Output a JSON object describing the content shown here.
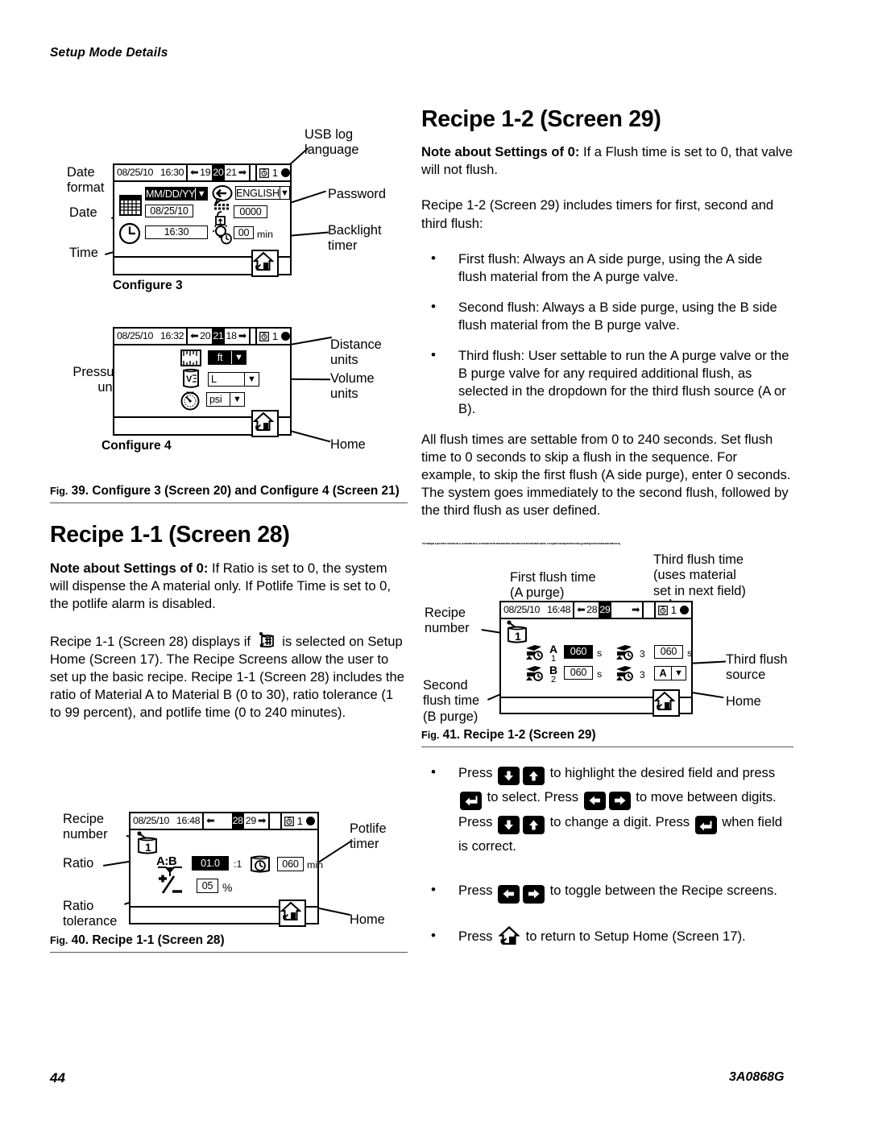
{
  "header": {
    "running_head": "Setup Mode Details"
  },
  "footer": {
    "page_number": "44",
    "doc_code": "3A0868G"
  },
  "left_column": {
    "fig39": {
      "caption_prefix": "Fig.",
      "caption": " 39. Configure 3 (Screen 20) and Configure 4 (Screen 21)",
      "screen_name_3": "Configure 3",
      "screen_name_4": "Configure 4",
      "callouts": {
        "date_format": "Date\nformat",
        "date": "Date",
        "time": "Time",
        "usb_log_language": "USB log\nlanguage",
        "password": "Password",
        "backlight_timer": "Backlight\ntimer",
        "pressure_units": "Pressure\nunits",
        "distance_units": "Distance\nunits",
        "volume_units": "Volume\nunits",
        "home": "Home"
      },
      "configure3": {
        "date_stamp": "08/25/10",
        "time_stamp": "16:30",
        "nav_prev": "19",
        "nav_cur": "20",
        "nav_next": "21",
        "status_num": "1",
        "date_format_value": "MM/DD/YY",
        "date_value": "08/25/10",
        "time_value": "16:30",
        "language_value": "ENGLISH",
        "password_value": "0000",
        "backlight_value": "00",
        "backlight_unit": "min"
      },
      "configure4": {
        "date_stamp": "08/25/10",
        "time_stamp": "16:32",
        "nav_prev": "20",
        "nav_cur": "21",
        "nav_next": "18",
        "status_num": "1",
        "distance_value": "ft",
        "volume_value": "L",
        "pressure_value": "psi"
      }
    },
    "recipe11": {
      "title": "Recipe 1-1 (Screen 28)",
      "note_label": "Note about Settings of 0:",
      "note_text": " If Ratio is set to 0, the system will dispense the A material only. If Potlife Time is set to 0, the potlife alarm is disabled.",
      "para_a": "Recipe 1-1 (Screen 28) displays if ",
      "para_b": " is selected on Setup Home (Screen 17). The Recipe Screens allow the user to set up the basic recipe. Recipe 1-1 (Screen 28) includes the ratio of Material A to Material B (0 to 30), ratio tolerance (1 to 99 percent), and potlife time (0 to 240 minutes)."
    },
    "fig40": {
      "caption_prefix": "Fig.",
      "caption": " 40. Recipe 1-1 (Screen 28)",
      "callouts": {
        "recipe_number": "Recipe\nnumber",
        "ratio": "Ratio",
        "ratio_tolerance": "Ratio\ntolerance",
        "potlife_timer": "Potlife\ntimer",
        "home": "Home"
      },
      "screen": {
        "date_stamp": "08/25/10",
        "time_stamp": "16:48",
        "nav_cur": "28",
        "nav_next": "29",
        "status_num": "1",
        "recipe_number_value": "1",
        "ratio_label": "A:B",
        "ratio_value": "01.0",
        "ratio_suffix": ":1",
        "tolerance_value": "05",
        "tolerance_unit": "%",
        "potlife_value": "060",
        "potlife_unit": "min"
      }
    }
  },
  "right_column": {
    "recipe12": {
      "title": "Recipe 1-2 (Screen 29)",
      "note_label": "Note about Settings of 0:",
      "note_text": " If a Flush time is set to 0, that valve will not flush.",
      "intro": "Recipe 1-2 (Screen 29) includes timers for first, second and third flush:",
      "bullets": [
        "First flush: Always an A side purge, using the A side flush material from the A purge valve.",
        "Second flush: Always a B side purge, using the B side flush material from the B purge valve.",
        "Third flush: User settable to run the A purge valve or the B purge valve for any required additional flush, as selected in the dropdown for the third flush source (A or B)."
      ],
      "para_after": "All flush times are settable from 0 to 240 seconds. Set flush time to 0 seconds to skip a flush in the sequence. For example, to skip the first flush (A side purge), enter 0 seconds. The system goes immediately to the second flush, followed by the third flush as user defined."
    },
    "overlap_line": "For example, if you enter 0 seconds for A, 30 seconds for B, 30 seconds for the third flush time, and select A for the third flush source. The system will skip the first A flush, go directly to the second flush with the B purge valve for 30 seconds followed by the",
    "fig41": {
      "caption_prefix": "Fig.",
      "caption": " 41. Recipe 1-2 (Screen 29)",
      "callouts": {
        "recipe_number": "Recipe\nnumber",
        "first_flush": "First flush time\n(A purge)",
        "third_flush_time": "Third flush time\n(uses material\nset in next field)",
        "third_flush_source": "Third flush\nsource",
        "second_flush": "Second\nflush time\n(B purge)",
        "home": "Home"
      },
      "screen": {
        "date_stamp": "08/25/10",
        "time_stamp": "16:48",
        "nav_prev": "28",
        "nav_cur": "29",
        "status_num": "1",
        "recipe_number_value": "1",
        "flush_a_letter": "A",
        "flush_a_index": "1",
        "flush_a_value": "060",
        "flush_a_unit": "s",
        "flush_b_letter": "B",
        "flush_b_index": "2",
        "flush_b_value": "060",
        "flush_b_unit": "s",
        "flush_3_index_top": "3",
        "flush_3_index_bot": "3",
        "flush_3_value": "060",
        "flush_3_unit": "s",
        "third_source_value": "A"
      }
    },
    "instructions": [
      {
        "parts": [
          {
            "t": "text",
            "v": "Press "
          },
          {
            "t": "key",
            "v": "down-arrow-key"
          },
          {
            "t": "key",
            "v": "up-arrow-key"
          },
          {
            "t": "text",
            "v": " to highlight the desired field and press "
          },
          {
            "t": "key",
            "v": "enter-key"
          },
          {
            "t": "text",
            "v": " to select. Press "
          },
          {
            "t": "key",
            "v": "left-arrow-key"
          },
          {
            "t": "key",
            "v": "right-arrow-key"
          },
          {
            "t": "text",
            "v": " to move between digits. Press "
          },
          {
            "t": "key",
            "v": "down-arrow-key"
          },
          {
            "t": "key",
            "v": "up-arrow-key"
          },
          {
            "t": "text",
            "v": " to change a digit. Press "
          },
          {
            "t": "key",
            "v": "enter-key"
          },
          {
            "t": "text",
            "v": " when field is correct."
          }
        ]
      },
      {
        "parts": [
          {
            "t": "text",
            "v": "Press "
          },
          {
            "t": "key",
            "v": "left-arrow-key"
          },
          {
            "t": "key",
            "v": "right-arrow-key"
          },
          {
            "t": "text",
            "v": " to toggle between the Recipe screens."
          }
        ]
      },
      {
        "parts": [
          {
            "t": "text",
            "v": "Press "
          },
          {
            "t": "home",
            "v": "home-icon"
          },
          {
            "t": "text",
            "v": " to return to Setup Home (Screen 17)."
          }
        ]
      }
    ]
  },
  "colors": {
    "ink": "#000000",
    "paper": "#ffffff",
    "rule": "#555555"
  }
}
